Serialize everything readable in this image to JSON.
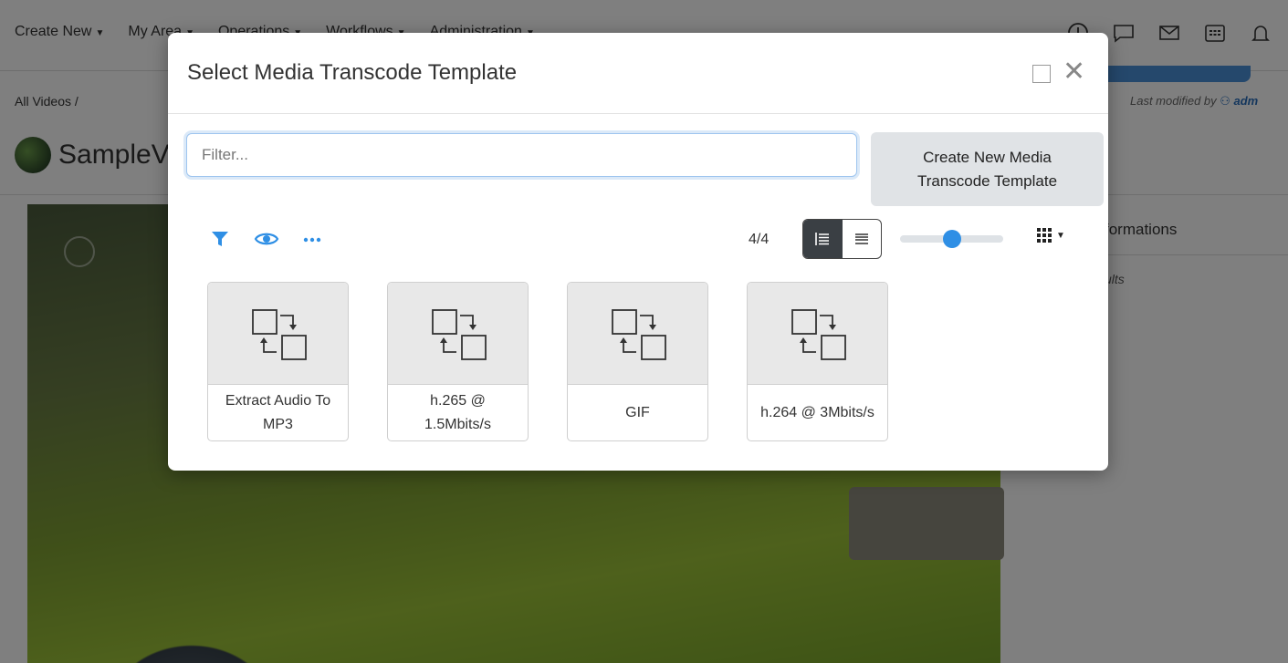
{
  "nav": {
    "items": [
      {
        "label": "Create New"
      },
      {
        "label": "My Area"
      },
      {
        "label": "Operations"
      },
      {
        "label": "Workflows"
      },
      {
        "label": "Administration"
      }
    ],
    "icons": [
      "clock-icon",
      "chat-icon",
      "mail-icon",
      "calendar-icon",
      "bell-icon"
    ]
  },
  "page": {
    "breadcrumb": "All Videos /",
    "last_modified_prefix": "Last modified by",
    "last_modified_user": "adm",
    "title": "SampleV",
    "side_tab": "formations",
    "side_results": "ults"
  },
  "modal": {
    "title": "Select Media Transcode Template",
    "filter_placeholder": "Filter...",
    "create_button": "Create New Media Transcode Template",
    "count": "4/4",
    "zoom_slider_level": 0.5,
    "templates": [
      {
        "label": "Extract Audio To MP3"
      },
      {
        "label": "h.265 @ 1.5Mbits/s"
      },
      {
        "label": "GIF"
      },
      {
        "label": "h.264 @ 3Mbits/s"
      }
    ]
  },
  "colors": {
    "accent": "#2f8fe5",
    "overlay": "rgba(0,0,0,0.5)",
    "card_thumb_bg": "#e8e8e8",
    "toggle_active": "#3a3f44"
  }
}
